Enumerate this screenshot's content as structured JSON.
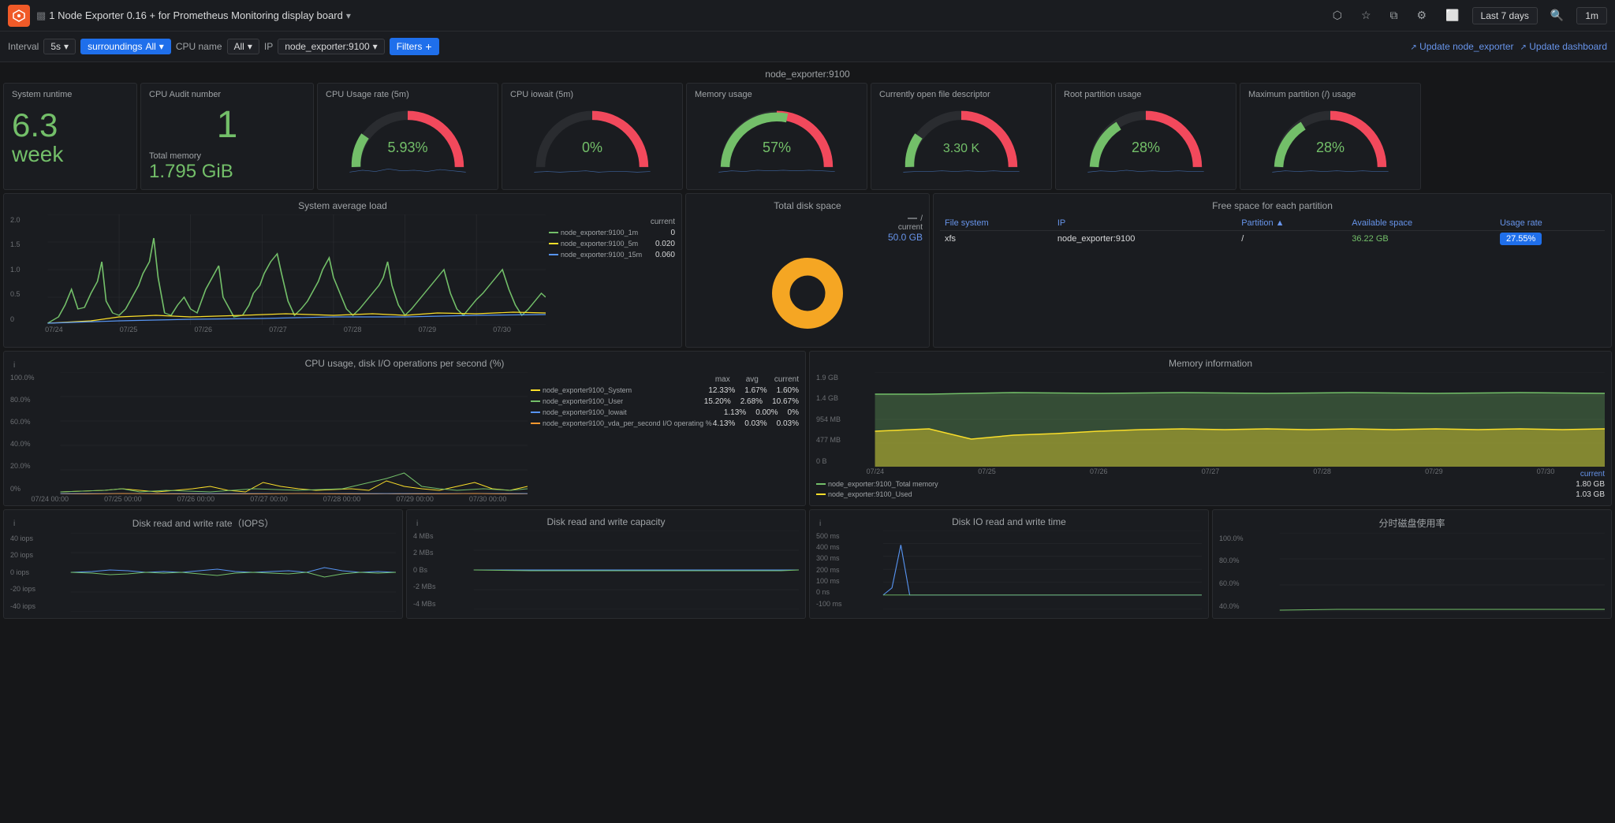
{
  "header": {
    "title": "1 Node Exporter 0.16 + for Prometheus Monitoring display board",
    "icon": "⬡",
    "update_node": "Update node_exporter",
    "update_dashboard": "Update dashboard"
  },
  "toolbar": {
    "interval_label": "Interval",
    "interval_value": "5s",
    "surroundings_label": "surroundings",
    "surroundings_value": "All",
    "cpu_name_label": "CPU name",
    "cpu_name_value": "All",
    "ip_label": "IP",
    "ip_value": "node_exporter:9100",
    "filters_label": "Filters"
  },
  "top_section": {
    "host_label": "node_exporter:9100",
    "time_range": "Last 7 days",
    "refresh": "1m"
  },
  "metrics": {
    "system_runtime": {
      "title": "System runtime",
      "value": "6.3",
      "unit": "week"
    },
    "cpu_audit": {
      "title": "CPU Audit number",
      "count": "1",
      "sub_title": "Total memory",
      "memory": "1.795 GiB"
    },
    "cpu_usage": {
      "title": "CPU Usage rate (5m)",
      "value": "5.93%",
      "percentage": 5.93
    },
    "cpu_iowait": {
      "title": "CPU iowait (5m)",
      "value": "0%",
      "percentage": 0
    },
    "memory_usage": {
      "title": "Memory usage",
      "value": "57%",
      "percentage": 57
    },
    "open_file": {
      "title": "Currently open file descriptor",
      "value": "3.30 K"
    },
    "root_partition": {
      "title": "Root partition usage",
      "value": "28%",
      "percentage": 28
    },
    "max_partition": {
      "title": "Maximum partition (/) usage",
      "value": "28%",
      "percentage": 28
    }
  },
  "system_avg_load": {
    "title": "System average load",
    "legend": [
      {
        "label": "node_exporter:9100_1m",
        "color": "#73bf69",
        "current": "0"
      },
      {
        "label": "node_exporter:9100_5m",
        "color": "#fade2a",
        "current": "0.020"
      },
      {
        "label": "node_exporter:9100_15m",
        "color": "#5794f2",
        "current": "0.060"
      }
    ],
    "x_labels": [
      "07/24",
      "07/25",
      "07/26",
      "07/27",
      "07/28",
      "07/29",
      "07/30"
    ],
    "y_labels": [
      "2.0",
      "1.5",
      "1.0",
      "0.5",
      "0"
    ]
  },
  "total_disk": {
    "title": "Total disk space",
    "partition": "/",
    "current_label": "current",
    "value": "50.0 GB"
  },
  "free_space": {
    "title": "Free space for each partition",
    "columns": [
      "File system",
      "IP",
      "Partition",
      "Available space",
      "Usage rate"
    ],
    "rows": [
      {
        "filesystem": "xfs",
        "ip": "node_exporter:9100",
        "partition": "/",
        "available": "36.22 GB",
        "usage": "27.55%"
      }
    ]
  },
  "cpu_disk_ops": {
    "title": "CPU usage, disk I/O operations per second (%)",
    "legend": [
      {
        "label": "node_exporter9100_System",
        "color": "#fade2a",
        "max": "12.33%",
        "avg": "1.67%",
        "current": "1.60%"
      },
      {
        "label": "node_exporter9100_User",
        "color": "#73bf69",
        "max": "15.20%",
        "avg": "2.68%",
        "current": "10.67%"
      },
      {
        "label": "node_exporter9100_Iowait",
        "color": "#5794f2",
        "max": "1.13%",
        "avg": "0.00%",
        "current": "0%"
      },
      {
        "label": "node_exporter9100_vda_per_second I/O operating %",
        "color": "#f2495c",
        "max": "4.13%",
        "avg": "0.03%",
        "current": "0.03%"
      }
    ],
    "y_labels": [
      "100.0%",
      "80.0%",
      "60.0%",
      "40.0%",
      "20.0%",
      "0%"
    ],
    "x_labels": [
      "07/24 00:00",
      "07/25 00:00",
      "07/26 00:00",
      "07/27 00:00",
      "07/28 00:00",
      "07/29 00:00",
      "07/30 00:00"
    ]
  },
  "memory_info": {
    "title": "Memory information",
    "y_labels": [
      "1.9 GB",
      "1.4 GB",
      "954 MB",
      "477 MB",
      "0 B"
    ],
    "x_labels": [
      "07/24",
      "07/25",
      "07/26",
      "07/27",
      "07/28",
      "07/29",
      "07/30"
    ],
    "legend": [
      {
        "label": "node_exporter:9100_Total memory",
        "color": "#73bf69",
        "current": "1.80 GB"
      },
      {
        "label": "node_exporter:9100_Used",
        "color": "#fade2a",
        "current": "1.03 GB"
      }
    ],
    "current_label": "current"
  },
  "disk_rw_rate": {
    "title": "Disk read and write rate（IOPS）",
    "y_labels": [
      "40 iops",
      "20 iops",
      "0 iops",
      "-20 iops",
      "-40 iops"
    ]
  },
  "disk_rw_capacity": {
    "title": "Disk read and write capacity",
    "y_labels": [
      "4 MBs",
      "2 MBs",
      "0 Bs",
      "-2 MBs",
      "-4 MBs"
    ]
  },
  "disk_io_time": {
    "title": "Disk IO read and write time",
    "y_labels": [
      "500 ms",
      "400 ms",
      "300 ms",
      "200 ms",
      "100 ms",
      "0 ns",
      "-100 ms"
    ]
  },
  "disk_usage_rate": {
    "title": "分时磁盘使用率",
    "y_labels": [
      "100.0%",
      "80.0%",
      "60.0%",
      "40.0%"
    ]
  }
}
